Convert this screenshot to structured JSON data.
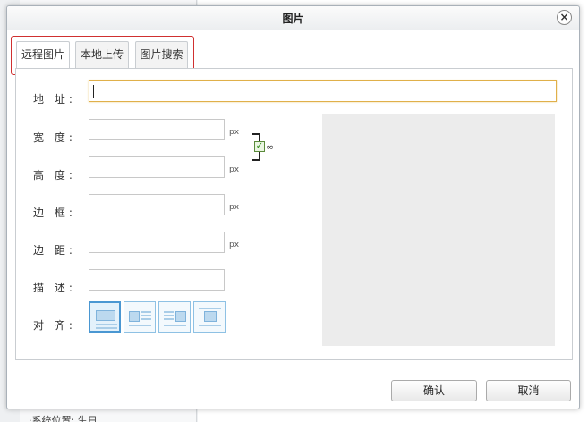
{
  "dialog": {
    "title": "图片",
    "close_symbol": "×"
  },
  "tabs": [
    {
      "label": "远程图片",
      "active": true
    },
    {
      "label": "本地上传",
      "active": false
    },
    {
      "label": "图片搜索",
      "active": false
    }
  ],
  "form": {
    "address_label": "地 址:",
    "address_value": "",
    "width_label": "宽 度:",
    "width_value": "",
    "height_label": "高 度:",
    "height_value": "",
    "border_label": "边 框:",
    "border_value": "",
    "margin_label": "边 距:",
    "margin_value": "",
    "desc_label": "描 述:",
    "desc_value": "",
    "align_label": "对 齐:",
    "unit": "px",
    "lock_ratio_checked": true,
    "lock_check_symbol": "✓",
    "lock_link_symbol": "∞"
  },
  "align_options": [
    {
      "name": "none",
      "selected": true
    },
    {
      "name": "left",
      "selected": false
    },
    {
      "name": "right",
      "selected": false
    },
    {
      "name": "center",
      "selected": false
    }
  ],
  "buttons": {
    "ok": "确认",
    "cancel": "取消"
  },
  "background": {
    "bottom_text": "·系统位置:  生日"
  },
  "colors": {
    "focus_border": "#e0b04a",
    "tab_highlight": "#d03030",
    "preview_bg": "#ececec",
    "align_selected": "#4a97d2"
  },
  "icons": {
    "close": "close-icon",
    "lock": "lock-ratio-icon",
    "link": "link-icon"
  }
}
